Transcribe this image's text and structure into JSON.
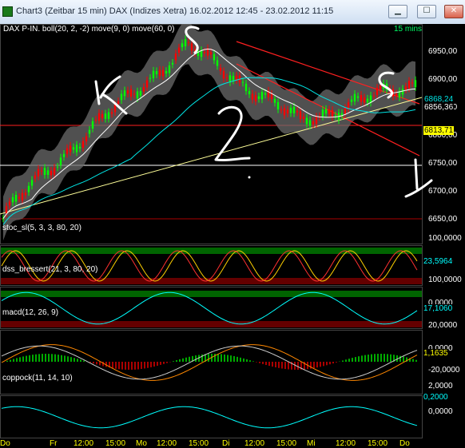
{
  "window": {
    "title": "Chart3 (Zeitbar 15 min)  DAX (Indizes Xetra) 16.02.2012 12:45 - 23.02.2012 11:15",
    "controls": [
      "minimize",
      "maximize",
      "close"
    ]
  },
  "main_panel": {
    "label": "DAX P-IN.  boll(20, 2, -2) move(9, 0) move(60, 0)",
    "timeframe": "15 mins",
    "y_ticks": [
      "6950,00",
      "6900,00",
      "6850,00",
      "6800,00",
      "6750,00",
      "6700,00",
      "6650,00"
    ],
    "price_labels": [
      {
        "text": "6868,24",
        "color": "#00e5e5"
      },
      {
        "text": "6856,36",
        "color": "#ffffff"
      },
      {
        "text": "6813,71",
        "color": "#ffff00"
      }
    ],
    "handwriting": [
      "S",
      "K",
      "2",
      "S",
      "1"
    ]
  },
  "indicators": [
    {
      "label": "stoc_sl(5, 3, 3, 80, 20)",
      "ticks": [
        "100,0000",
        "0,0000"
      ],
      "value": "23,5964"
    },
    {
      "label": "dss_bressert(21, 3, 80, 20)",
      "ticks": [
        "100,0000",
        "0,0000"
      ],
      "value": "17,1060"
    },
    {
      "label": "macd(12, 26, 9)",
      "ticks": [
        "20,0000",
        "0,0000",
        "-20,0000"
      ],
      "value": "1,1635"
    },
    {
      "label": "coppock(11, 14, 10)",
      "ticks": [
        "2,0000",
        "0,0000"
      ],
      "value": "0,2000"
    }
  ],
  "x_axis": [
    "Do",
    "Fr",
    "12:00",
    "15:00",
    "Mo",
    "12:00",
    "15:00",
    "Di",
    "12:00",
    "15:00",
    "Mi",
    "12:00",
    "15:00",
    "Do"
  ],
  "colors": {
    "background": "#000000",
    "axis_text": "#ffffff",
    "candle_up": "#00ff00",
    "candle_down": "#ff0000",
    "bollinger_fill": "#6b6b6b",
    "ma_fast": "#ffffff",
    "ma_slow": "#00e5e5",
    "trendline": "#ffff99",
    "channel": "#ff2020",
    "stoch_k": "#ffd000",
    "stoch_d": "#ff3030",
    "dss": "#00ffff",
    "macd": "#ff8800",
    "signal": "#cccccc",
    "coppock": "#00ffff",
    "ob_zone": "#006400",
    "os_zone": "#640000"
  }
}
